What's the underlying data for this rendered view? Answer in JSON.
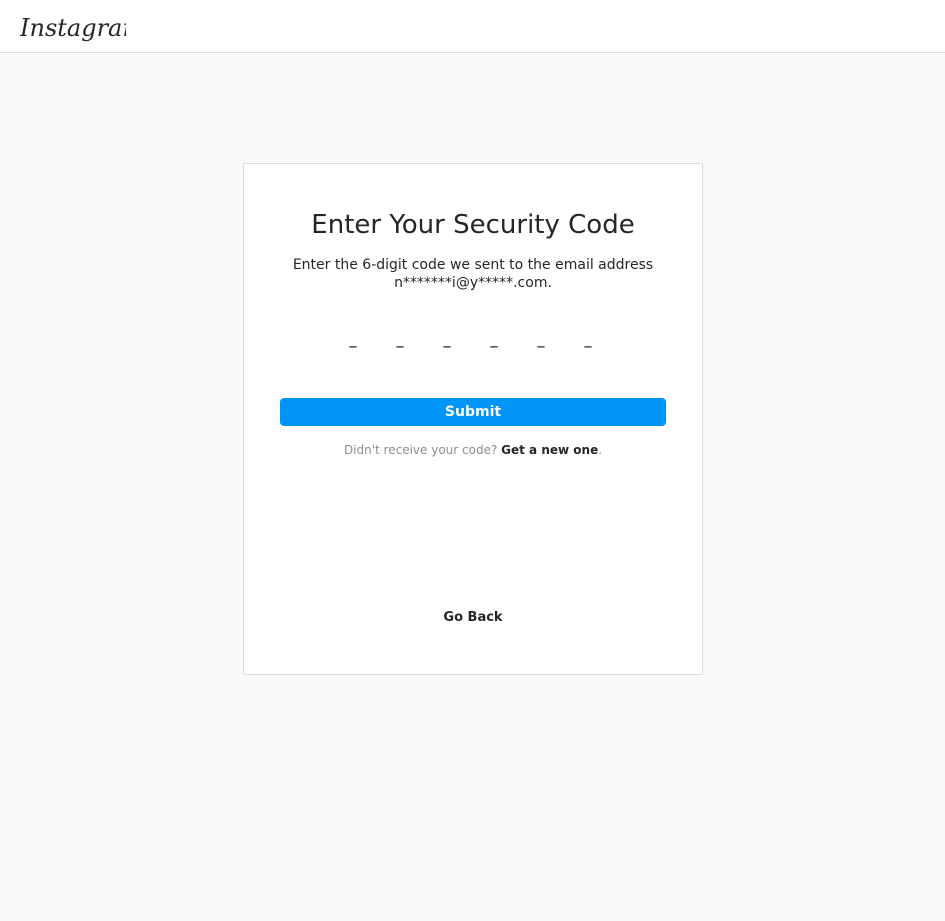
{
  "header": {
    "logo_text": "Instagram"
  },
  "card": {
    "title": "Enter Your Security Code",
    "instruction_line1": "Enter the 6-digit code we sent to the email address",
    "instruction_line2": "n*******i@y*****.com.",
    "code_slots": [
      "–",
      "–",
      "–",
      "–",
      "–",
      "–"
    ],
    "submit_label": "Submit",
    "resend_prompt": "Didn't receive your code?",
    "resend_link": "Get a new one",
    "resend_suffix": ".",
    "go_back_label": "Go Back"
  },
  "colors": {
    "accent": "#0095f6",
    "background": "#fafafa",
    "border": "#dbdbdb",
    "text": "#262626",
    "muted_text": "#8e8e8e"
  }
}
